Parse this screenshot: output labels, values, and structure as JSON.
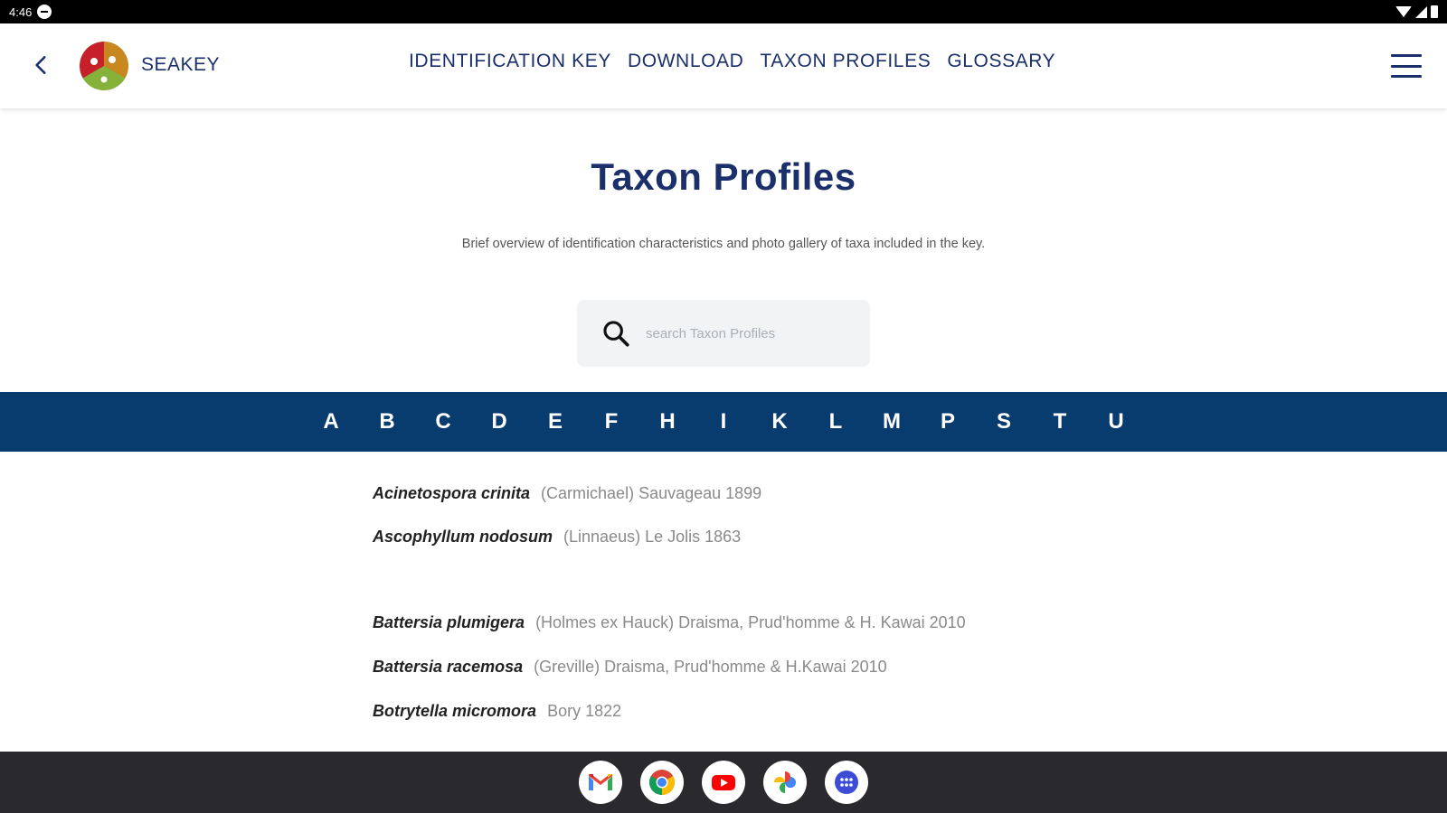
{
  "status_bar": {
    "time": "4:46"
  },
  "header": {
    "brand": "SEAKEY",
    "nav": [
      {
        "label": "IDENTIFICATION KEY"
      },
      {
        "label": "DOWNLOAD"
      },
      {
        "label": "TAXON PROFILES"
      },
      {
        "label": "GLOSSARY"
      }
    ]
  },
  "page": {
    "title": "Taxon Profiles",
    "subtitle": "Brief overview of identification characteristics and photo gallery of taxa included in the key."
  },
  "search": {
    "placeholder": "search Taxon Profiles"
  },
  "alphabet": [
    "A",
    "B",
    "C",
    "D",
    "E",
    "F",
    "H",
    "I",
    "K",
    "L",
    "M",
    "P",
    "S",
    "T",
    "U"
  ],
  "taxa": [
    {
      "name": "Acinetospora crinita",
      "author": "(Carmichael) Sauvageau 1899"
    },
    {
      "name": "Ascophyllum nodosum",
      "author": "(Linnaeus) Le Jolis 1863"
    },
    {
      "name": "Battersia plumigera",
      "author": "(Holmes ex Hauck) Draisma, Prud'homme & H. Kawai 2010"
    },
    {
      "name": "Battersia racemosa",
      "author": "(Greville) Draisma, Prud'homme & H.Kawai 2010"
    },
    {
      "name": "Botrytella micromora",
      "author": "Bory 1822"
    }
  ],
  "dock": {
    "apps": [
      {
        "icon": "gmail-icon"
      },
      {
        "icon": "chrome-icon"
      },
      {
        "icon": "youtube-icon"
      },
      {
        "icon": "photos-icon"
      },
      {
        "icon": "app-drawer-icon"
      }
    ]
  },
  "colors": {
    "brand_navy": "#1b2f6b",
    "alphabet_bar": "#083c6e",
    "taskbar": "#2a2a2e"
  }
}
